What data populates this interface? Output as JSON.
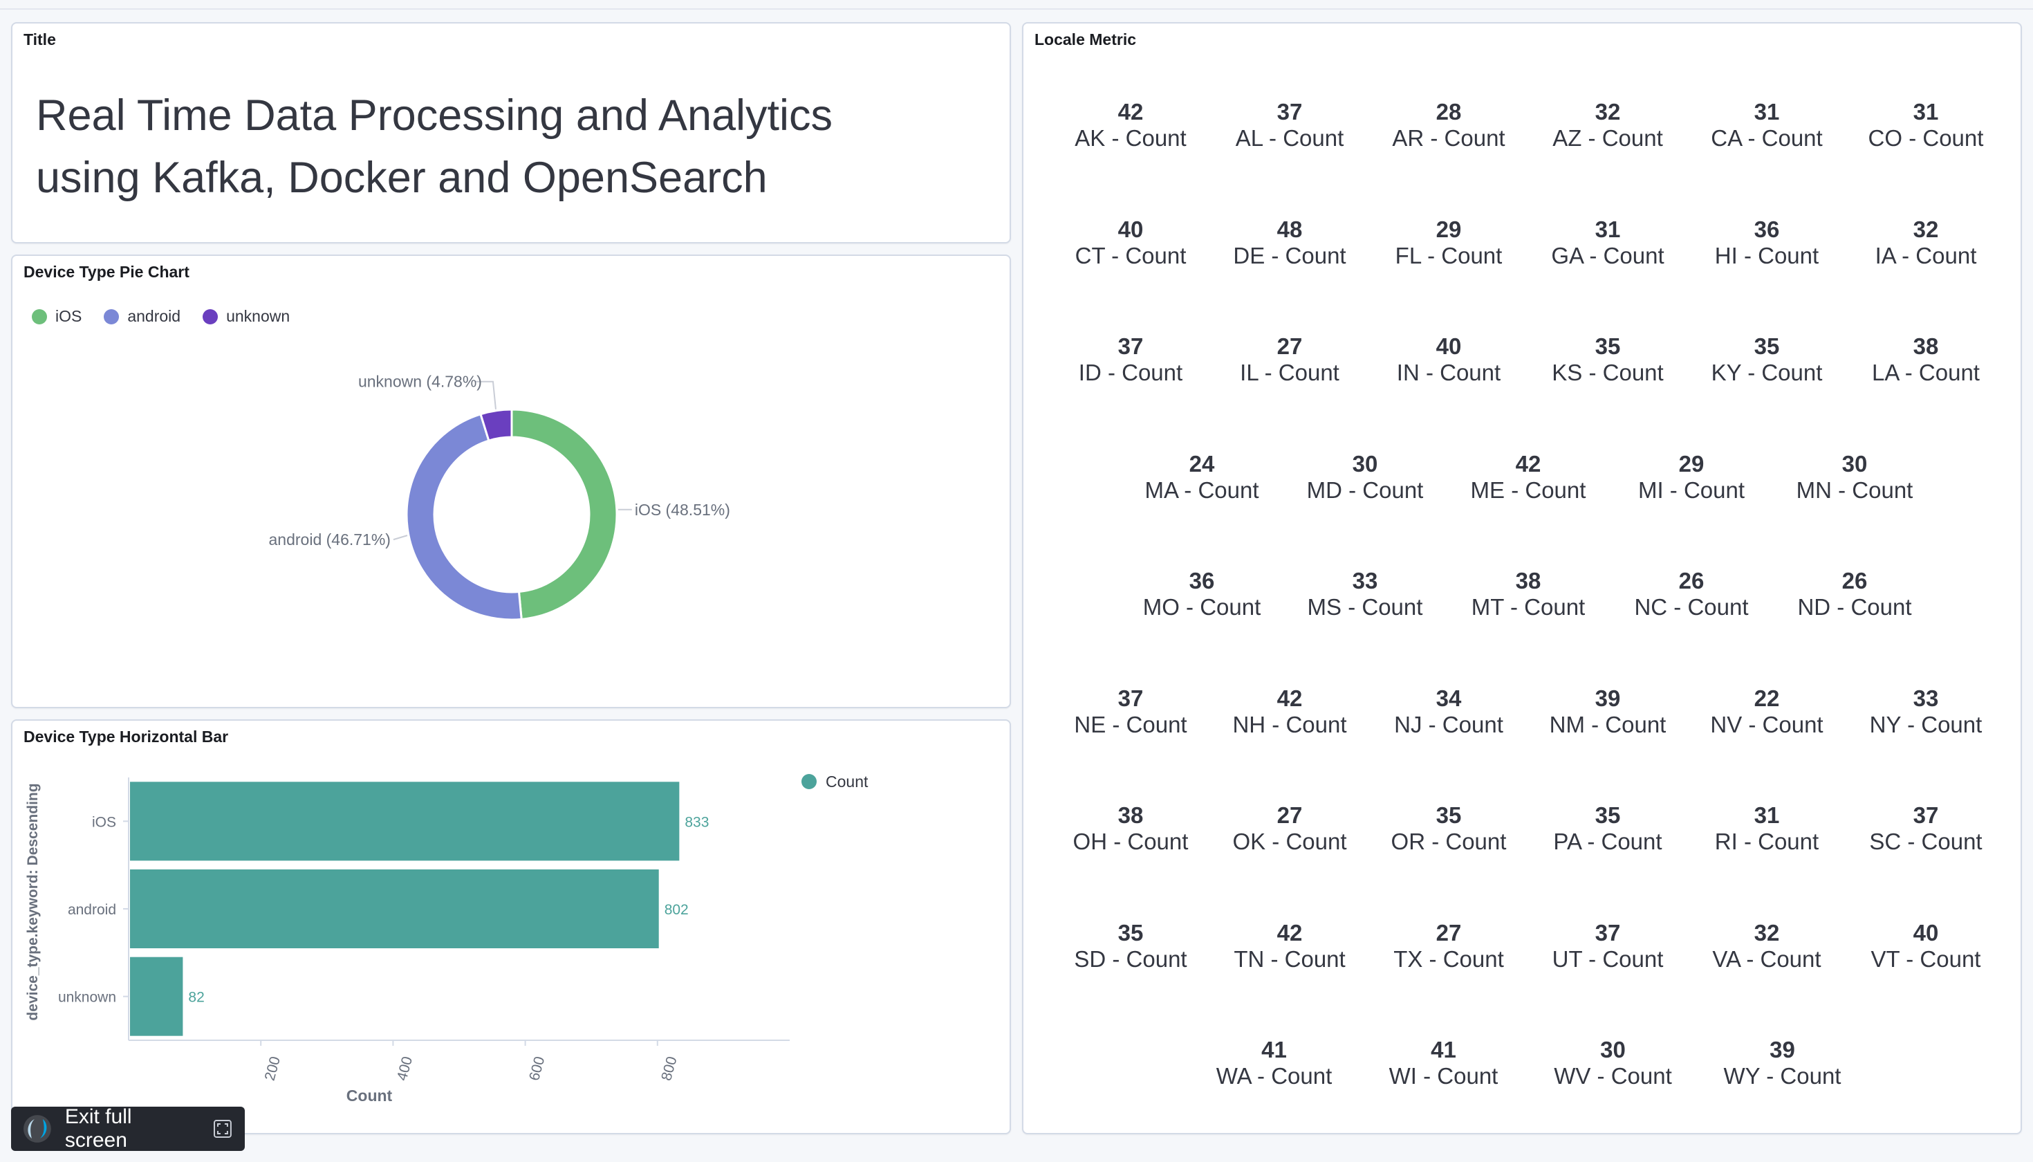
{
  "title_panel": {
    "title": "Title",
    "markdown": "Real Time Data Processing and Analytics using Kafka, Docker and OpenSearch"
  },
  "pie_panel": {
    "title": "Device Type Pie Chart",
    "legend": [
      {
        "label": "iOS",
        "color": "#6dbf7b"
      },
      {
        "label": "android",
        "color": "#7b88d6"
      },
      {
        "label": "unknown",
        "color": "#6a3fbf"
      }
    ],
    "chart_data": {
      "type": "pie",
      "donut": true,
      "slices": [
        {
          "label": "iOS",
          "percent": 48.51,
          "slice_label": "iOS (48.51%)",
          "color": "#6dbf7b"
        },
        {
          "label": "android",
          "percent": 46.71,
          "slice_label": "android (46.71%)",
          "color": "#7b88d6"
        },
        {
          "label": "unknown",
          "percent": 4.78,
          "slice_label": "unknown (4.78%)",
          "color": "#6a3fbf"
        }
      ]
    }
  },
  "bar_panel": {
    "title": "Device Type Horizontal Bar",
    "legend_label": "Count",
    "chart_data": {
      "type": "bar",
      "orientation": "horizontal",
      "categories": [
        "iOS",
        "android",
        "unknown"
      ],
      "values": [
        833,
        802,
        82
      ],
      "value_labels": [
        "833",
        "802",
        "82"
      ],
      "xlabel": "Count",
      "ylabel": "device_type.keyword: Descending",
      "xticks": [
        "200",
        "400",
        "600",
        "800"
      ],
      "xlim": [
        0,
        1000
      ],
      "color": "#4ca39b"
    }
  },
  "metric_panel": {
    "title": "Locale Metric",
    "rows": [
      [
        {
          "value": "42",
          "label": "AK - Count"
        },
        {
          "value": "37",
          "label": "AL - Count"
        },
        {
          "value": "28",
          "label": "AR - Count"
        },
        {
          "value": "32",
          "label": "AZ - Count"
        },
        {
          "value": "31",
          "label": "CA - Count"
        },
        {
          "value": "31",
          "label": "CO - Count"
        }
      ],
      [
        {
          "value": "40",
          "label": "CT - Count"
        },
        {
          "value": "48",
          "label": "DE - Count"
        },
        {
          "value": "29",
          "label": "FL - Count"
        },
        {
          "value": "31",
          "label": "GA - Count"
        },
        {
          "value": "36",
          "label": "HI - Count"
        },
        {
          "value": "32",
          "label": "IA - Count"
        }
      ],
      [
        {
          "value": "37",
          "label": "ID - Count"
        },
        {
          "value": "27",
          "label": "IL - Count"
        },
        {
          "value": "40",
          "label": "IN - Count"
        },
        {
          "value": "35",
          "label": "KS - Count"
        },
        {
          "value": "35",
          "label": "KY - Count"
        },
        {
          "value": "38",
          "label": "LA - Count"
        }
      ],
      [
        {
          "value": "24",
          "label": "MA - Count"
        },
        {
          "value": "30",
          "label": "MD - Count"
        },
        {
          "value": "42",
          "label": "ME - Count"
        },
        {
          "value": "29",
          "label": "MI - Count"
        },
        {
          "value": "30",
          "label": "MN - Count"
        }
      ],
      [
        {
          "value": "36",
          "label": "MO - Count"
        },
        {
          "value": "33",
          "label": "MS - Count"
        },
        {
          "value": "38",
          "label": "MT - Count"
        },
        {
          "value": "26",
          "label": "NC - Count"
        },
        {
          "value": "26",
          "label": "ND - Count"
        }
      ],
      [
        {
          "value": "37",
          "label": "NE - Count"
        },
        {
          "value": "42",
          "label": "NH - Count"
        },
        {
          "value": "34",
          "label": "NJ - Count"
        },
        {
          "value": "39",
          "label": "NM - Count"
        },
        {
          "value": "22",
          "label": "NV - Count"
        },
        {
          "value": "33",
          "label": "NY - Count"
        }
      ],
      [
        {
          "value": "38",
          "label": "OH - Count"
        },
        {
          "value": "27",
          "label": "OK - Count"
        },
        {
          "value": "35",
          "label": "OR - Count"
        },
        {
          "value": "35",
          "label": "PA - Count"
        },
        {
          "value": "31",
          "label": "RI - Count"
        },
        {
          "value": "37",
          "label": "SC - Count"
        }
      ],
      [
        {
          "value": "35",
          "label": "SD - Count"
        },
        {
          "value": "42",
          "label": "TN - Count"
        },
        {
          "value": "27",
          "label": "TX - Count"
        },
        {
          "value": "37",
          "label": "UT - Count"
        },
        {
          "value": "32",
          "label": "VA - Count"
        },
        {
          "value": "40",
          "label": "VT - Count"
        }
      ],
      [
        {
          "value": "41",
          "label": "WA - Count"
        },
        {
          "value": "41",
          "label": "WI - Count"
        },
        {
          "value": "30",
          "label": "WV - Count"
        },
        {
          "value": "39",
          "label": "WY - Count"
        }
      ]
    ]
  },
  "exit_button": {
    "label": "Exit full screen"
  }
}
